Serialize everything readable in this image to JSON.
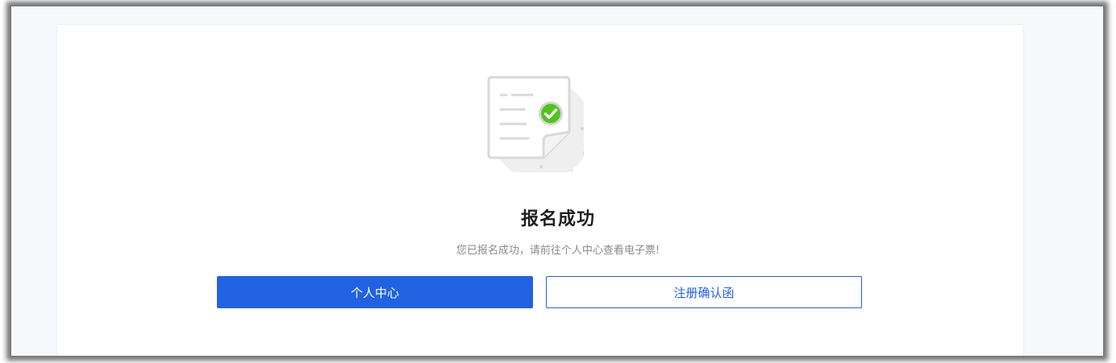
{
  "result": {
    "title": "报名成功",
    "message": "您已报名成功，请前往个人中心查看电子票!"
  },
  "actions": {
    "primary_label": "个人中心",
    "secondary_label": "注册确认函"
  },
  "colors": {
    "accent": "#2162e3",
    "success": "#52c41a",
    "title": "#1f1f1f",
    "muted": "#8a8a8a"
  },
  "icons": {
    "illustration": "document-success-icon"
  }
}
